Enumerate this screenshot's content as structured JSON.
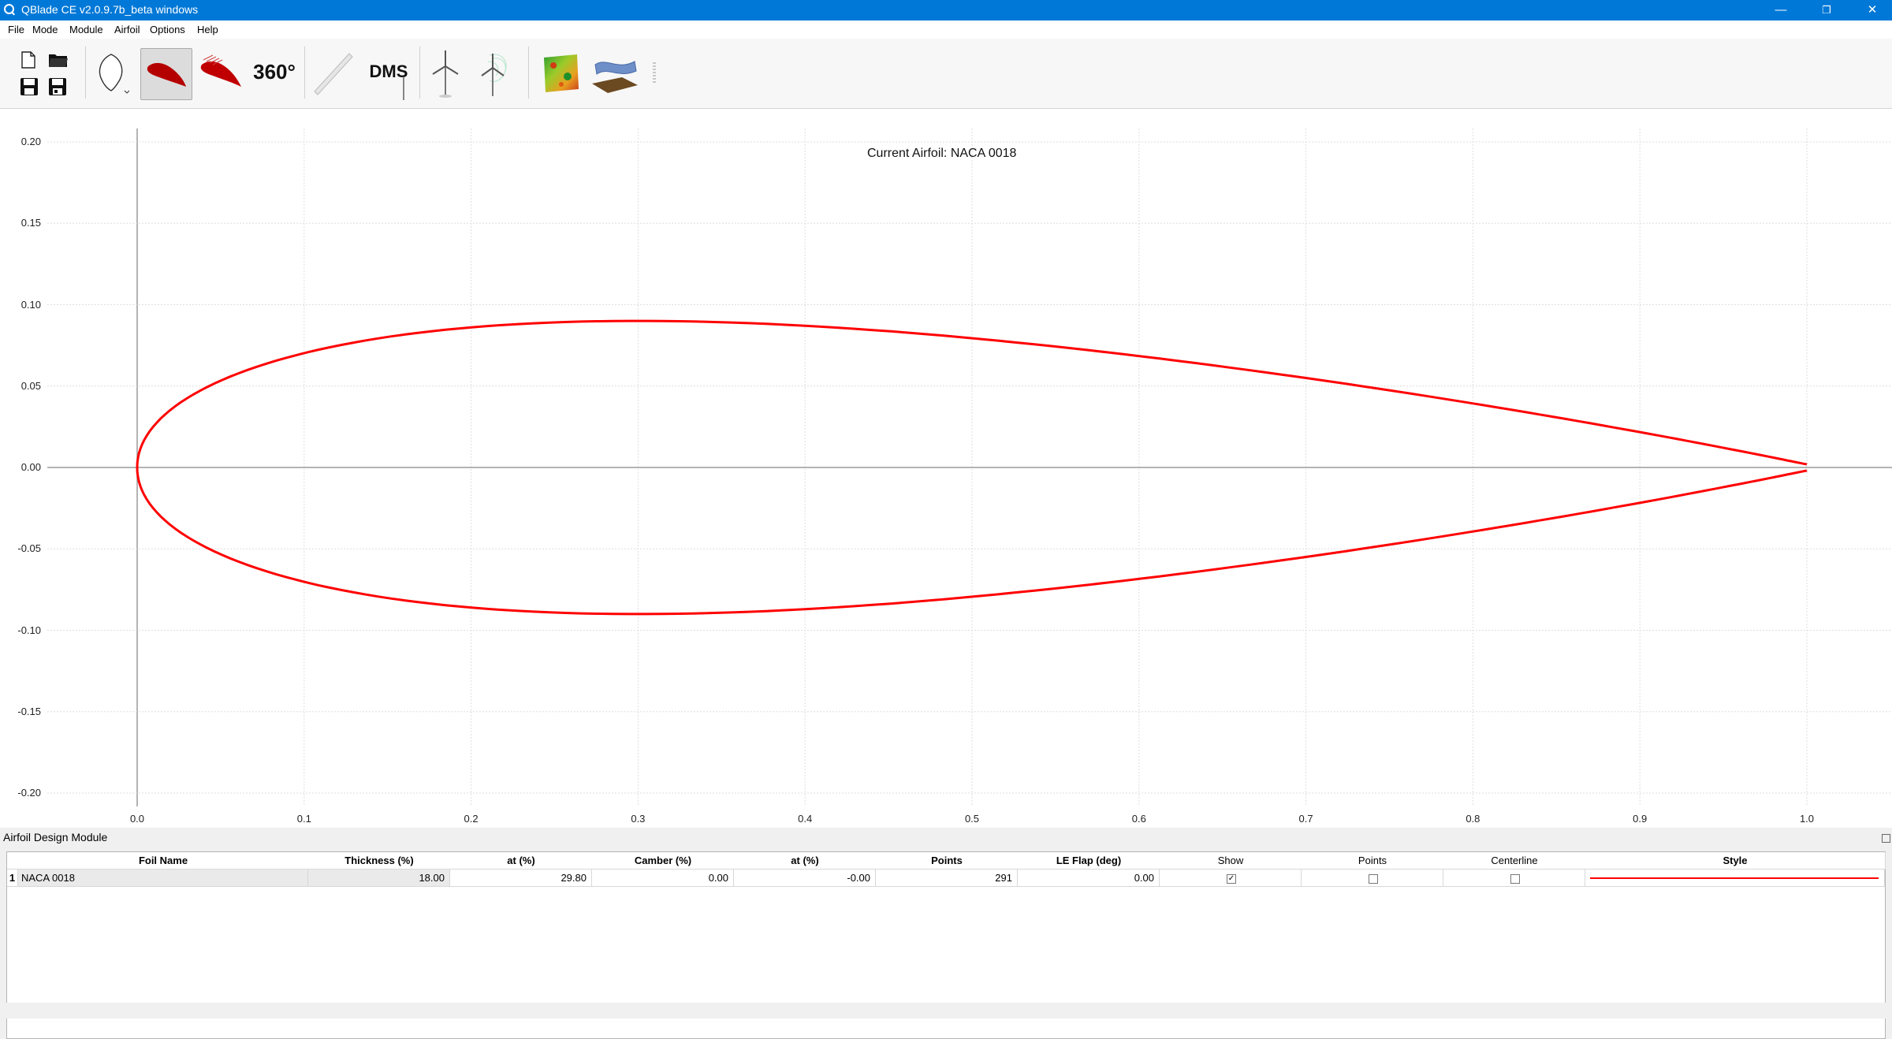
{
  "window": {
    "title": "QBlade CE v2.0.9.7b_beta windows",
    "minimize_glyph": "—",
    "restore_glyph": "❐",
    "close_glyph": "✕"
  },
  "menu": [
    "File",
    "Mode",
    "Module",
    "Airfoil",
    "Options",
    "Help"
  ],
  "toolbar": {
    "polar_360_label": "360°",
    "dms_label": "DMS",
    "icons": [
      "new-file-icon",
      "open-folder-icon",
      "save-icon",
      "save-as-icon",
      "airfoil-outline-icon",
      "airfoil-design-icon",
      "xfoil-analysis-icon",
      "polar-360-icon",
      "blade-design-icon",
      "dms-icon",
      "turbine-icon",
      "turbine-simulation-icon",
      "windfield-icon",
      "structural-icon"
    ]
  },
  "plot": {
    "title": "Current Airfoil: NACA 0018",
    "x_ticks": [
      "0.0",
      "0.1",
      "0.2",
      "0.3",
      "0.4",
      "0.5",
      "0.6",
      "0.7",
      "0.8",
      "0.9",
      "1.0"
    ],
    "y_ticks": [
      "0.20",
      "0.15",
      "0.10",
      "0.05",
      "0.00",
      "-0.05",
      "-0.10",
      "-0.15",
      "-0.20"
    ],
    "curve_color": "#ff0000"
  },
  "chart_data": {
    "type": "line",
    "title": "Current Airfoil: NACA 0018",
    "xlim": [
      -0.08,
      1.03
    ],
    "ylim": [
      -0.2,
      0.2
    ],
    "grid": true,
    "series": [
      {
        "name": "NACA 0018",
        "naca_thickness": 0.18
      }
    ]
  },
  "module": {
    "title": "Airfoil Design Module",
    "columns": [
      "Foil Name",
      "Thickness (%)",
      "at (%)",
      "Camber (%)",
      "at (%)",
      "Points",
      "LE Flap (deg)",
      "Show",
      "Points",
      "Centerline",
      "Style"
    ],
    "rows": [
      {
        "index": "1",
        "name": "NACA 0018",
        "thickness": "18.00",
        "thickness_at": "29.80",
        "camber": "0.00",
        "camber_at": "-0.00",
        "points": "291",
        "le_flap": "0.00",
        "show": true,
        "show_points": false,
        "centerline": false,
        "style_color": "#ff0000"
      }
    ]
  }
}
